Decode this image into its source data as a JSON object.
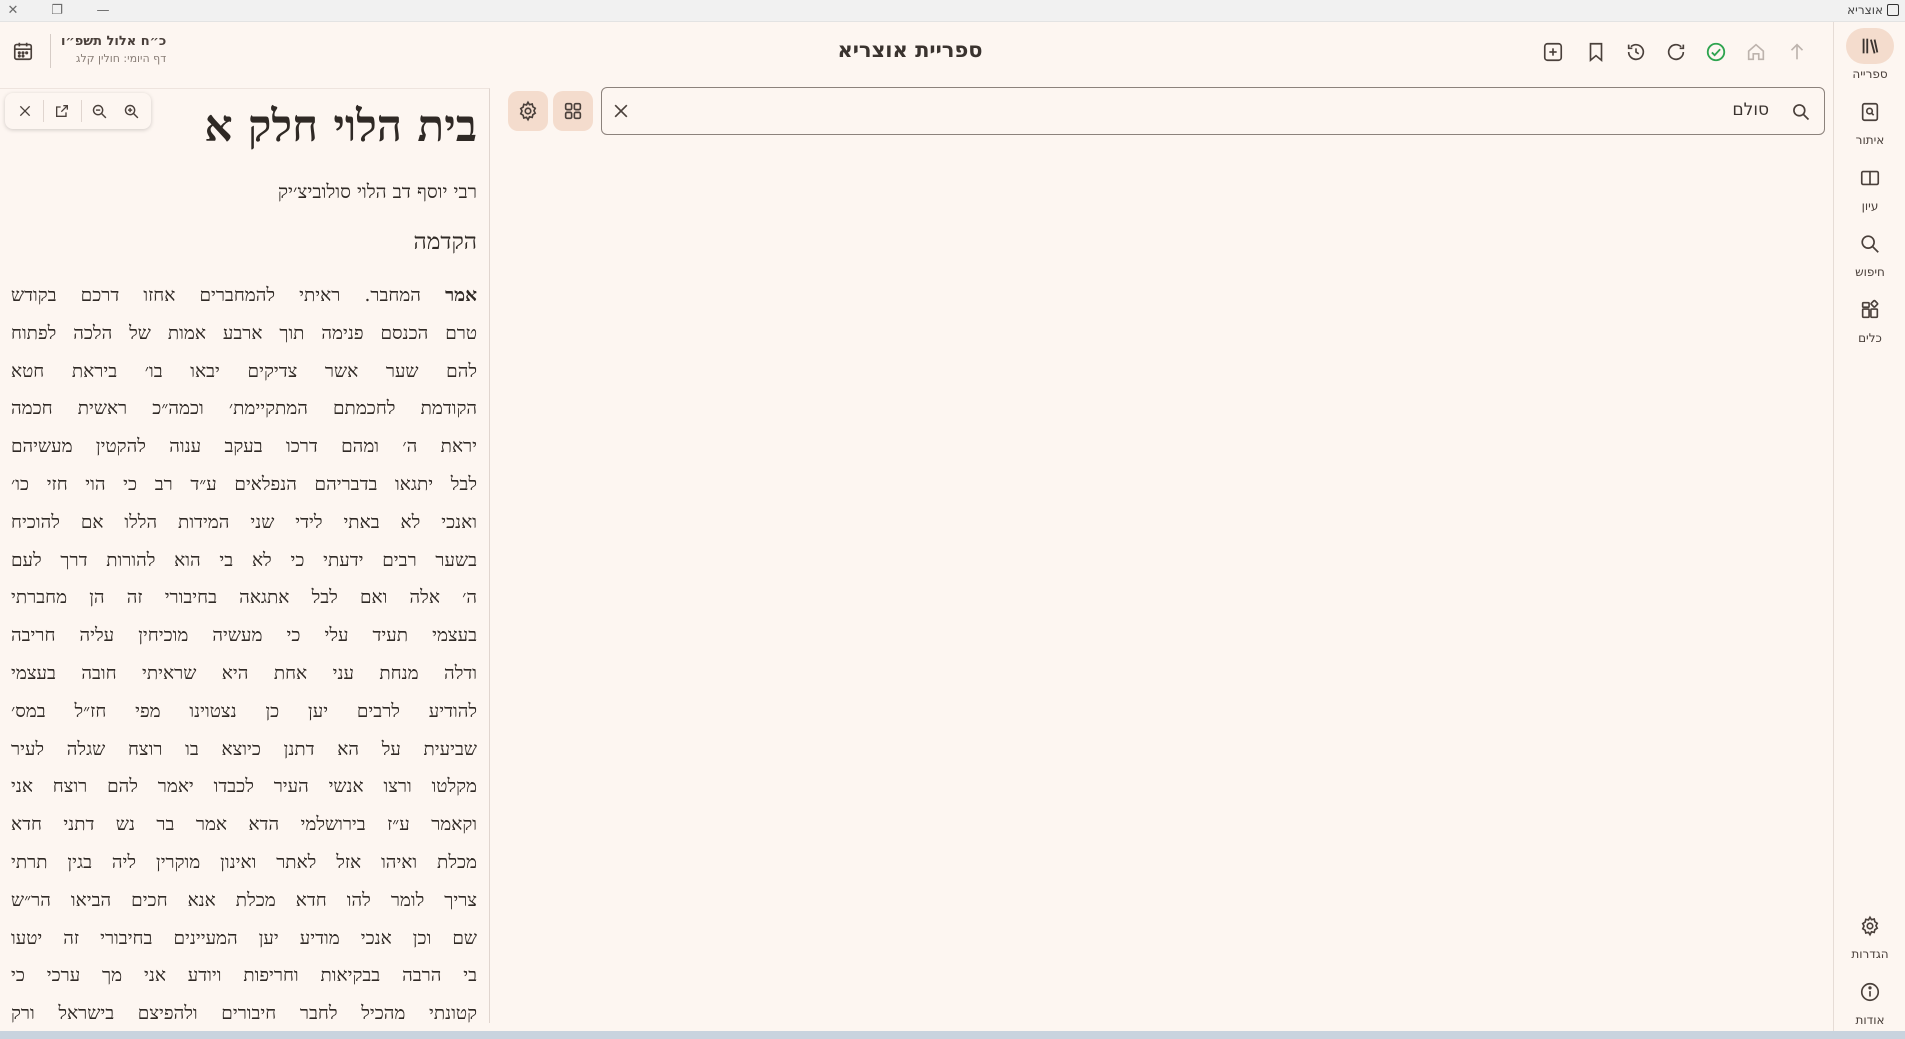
{
  "app": {
    "title": "אוצריא"
  },
  "header": {
    "title": "ספריית אוצריא",
    "date": {
      "hebrew": "כ״ח אלול תשפ״ו",
      "daf_yomi": "דף היומי: חולין קלג"
    }
  },
  "rail": {
    "items": [
      {
        "label": "ספרייה",
        "icon": "library-icon",
        "active": true
      },
      {
        "label": "איתור",
        "icon": "find-book-icon"
      },
      {
        "label": "עיון",
        "icon": "open-book-icon"
      },
      {
        "label": "חיפוש",
        "icon": "search-icon"
      },
      {
        "label": "כלים",
        "icon": "tools-icon"
      }
    ],
    "bottom": [
      {
        "label": "הגדרות",
        "icon": "settings-icon"
      },
      {
        "label": "אודות",
        "icon": "info-icon"
      }
    ]
  },
  "search": {
    "value": "סולם"
  },
  "reader": {
    "title": "בית הלוי חלק א",
    "author": "רבי יוסף דב הלוי סולוביצ׳יק",
    "section": "הקדמה",
    "first_word": "אמר",
    "lines": [
      "המחבר. ראיתי להמחברים אחזו דרכם בקודש",
      "טרם הכנסם פנימה תוך ארבע אמות של הלכה לפתוח",
      "להם שער אשר צדיקים יבאו בו׳ ביראת חטא",
      "הקודמת לחכמתם המתקיימת׳ וכמה״כ ראשית חכמה",
      "יראת ה׳ ומהם דרכו בעקב ענוה להקטין מעשיהם",
      "לבל יתגאו בדבריהם הנפלאים ע״ד רב כי הוי חזי כו׳",
      "ואנכי לא באתי לידי שני המידות הללו אם להוכיח",
      "בשער רבים ידעתי כי לא בי הוא להורות דרך לעם",
      "ה׳ אלה ואם לבל אתגאה בחיבורי זה הן מחברתי",
      "בעצמי תעיד עלי כי מעשיה מוכיחין עליה חריבה",
      "ודלה מנחת עני אחת היא שראיתי חובה בעצמי",
      "להודיע לרבים יען כן נצטוינו מפי חז״ל במס׳",
      "שביעית על הא דתנן כיוצא בו רוצח שגלה לעיר",
      "מקלטו ורצו אנשי העיר לכבדו יאמר להם רוצח אני",
      "וקאמר ע״ז בירושלמי הדא אמר בר נש דתני חדא",
      "מכלת ואיהו אזל לאתר ואינון מוקרין ליה בגין תרתי",
      "צריך לומר להו חדא מכלת אנא חכים הביאו הר״ש",
      "שם וכן אנכי מודיע יען המעיינים בחיבורי זה יטעו",
      "בי הרבה בבקיאות וחריפות ויודע אני מך ערכי כי",
      "קטונתי מהכיל לחבר חיבורים ולהפיצם בישראל ורק"
    ]
  }
}
